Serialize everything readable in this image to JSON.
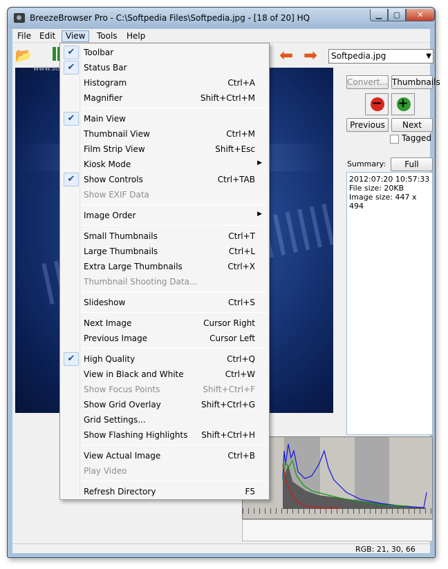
{
  "window": {
    "title": "BreezeBrowser Pro - C:\\Softpedia Files\\Softpedia.jpg - [18 of 20] HQ",
    "minimize": "▁",
    "maximize": "▢",
    "close": "✕"
  },
  "menubar": [
    "File",
    "Edit",
    "View",
    "Tools",
    "Help"
  ],
  "toolbar": {
    "file_selected": "Softpedia.jpg",
    "watermark": "www.softpedia.com"
  },
  "side_panel": {
    "convert": "Convert...",
    "thumbnails": "Thumbnails",
    "previous": "Previous",
    "next": "Next",
    "rotate_left": "−",
    "rotate_right": "+",
    "tagged": "Tagged",
    "summary_label": "Summary:",
    "full_details": "Full Details",
    "summary_lines": [
      "2012:07:20 10:57:33",
      "File size: 20KB",
      "Image size: 447 x 494"
    ]
  },
  "status": {
    "rgb": "RGB:  21, 30, 66"
  },
  "view_menu": [
    {
      "label": "Toolbar",
      "shortcut": "",
      "checked": true
    },
    {
      "label": "Status Bar",
      "shortcut": "",
      "checked": true
    },
    {
      "label": "Histogram",
      "shortcut": "Ctrl+A"
    },
    {
      "label": "Magnifier",
      "shortcut": "Shift+Ctrl+M"
    },
    {
      "label": "Main View",
      "shortcut": "",
      "checked": true
    },
    {
      "label": "Thumbnail View",
      "shortcut": "Ctrl+M"
    },
    {
      "label": "Film Strip View",
      "shortcut": "Shift+Esc"
    },
    {
      "label": "Kiosk Mode",
      "shortcut": "",
      "submenu": true
    },
    {
      "label": "Show Controls",
      "shortcut": "Ctrl+TAB",
      "checked": true
    },
    {
      "label": "Show EXIF Data",
      "shortcut": "",
      "disabled": true
    },
    {
      "label": "Image Order",
      "shortcut": "",
      "submenu": true
    },
    {
      "label": "Small Thumbnails",
      "shortcut": "Ctrl+T"
    },
    {
      "label": "Large Thumbnails",
      "shortcut": "Ctrl+L"
    },
    {
      "label": "Extra Large Thumbnails",
      "shortcut": "Ctrl+X"
    },
    {
      "label": "Thumbnail Shooting Data...",
      "shortcut": "",
      "disabled": true
    },
    {
      "label": "Slideshow",
      "shortcut": "Ctrl+S"
    },
    {
      "label": "Next Image",
      "shortcut": "Cursor Right"
    },
    {
      "label": "Previous Image",
      "shortcut": "Cursor Left"
    },
    {
      "label": "High Quality",
      "shortcut": "Ctrl+Q",
      "checked": true
    },
    {
      "label": "View in Black and White",
      "shortcut": "Ctrl+W"
    },
    {
      "label": "Show Focus Points",
      "shortcut": "Shift+Ctrl+F",
      "disabled": true
    },
    {
      "label": "Show Grid Overlay",
      "shortcut": "Shift+Ctrl+G"
    },
    {
      "label": "Grid Settings...",
      "shortcut": ""
    },
    {
      "label": "Show Flashing Highlights",
      "shortcut": "Shift+Ctrl+H"
    },
    {
      "label": "View Actual Image",
      "shortcut": "Ctrl+B"
    },
    {
      "label": "Play Video",
      "shortcut": "",
      "disabled": true
    },
    {
      "label": "Refresh Directory",
      "shortcut": "F5"
    }
  ],
  "check_glyph": "✔",
  "submenu_glyph": "▶",
  "colors": {
    "accent": "#3399ff",
    "arrow": "#e2571b",
    "rotate_left": "#d8261f",
    "rotate_right": "#2f9b2f"
  }
}
